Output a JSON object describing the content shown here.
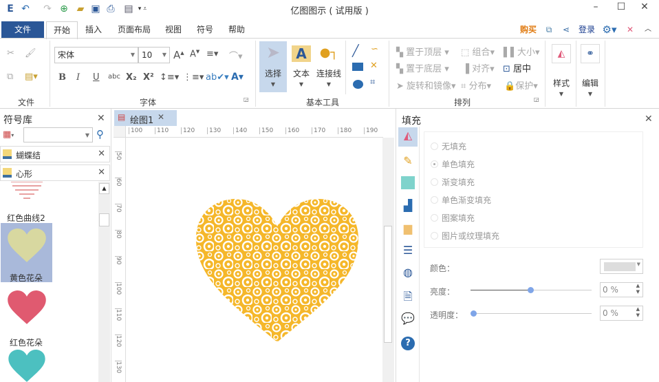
{
  "window": {
    "title": "亿图图示 ( 试用版 )",
    "minimize": "–",
    "maximize": "☐",
    "close": "✕"
  },
  "quick_access": [
    "app-logo",
    "undo",
    "redo",
    "new",
    "open",
    "save",
    "print",
    "export",
    "customize"
  ],
  "tabs": {
    "file": "文件",
    "items": [
      "开始",
      "插入",
      "页面布局",
      "视图",
      "符号",
      "帮助"
    ],
    "active": 0
  },
  "top_right": {
    "buy": "购买",
    "login": "登录"
  },
  "ribbon": {
    "file_group": "文件",
    "font_group": "字体",
    "font_name": "宋体",
    "font_size": "10",
    "format_buttons": [
      "B",
      "I",
      "U",
      "abc",
      "X₂",
      "X²"
    ],
    "basic_tools_group": "基本工具",
    "select": "选择",
    "text": "文本",
    "connector": "连接线",
    "arrange_group": "排列",
    "arrange": [
      "置于顶层",
      "置于底层",
      "旋转和镜像",
      "组合",
      "对齐",
      "分布",
      "大小",
      "居中",
      "保护"
    ],
    "style": "样式",
    "edit": "编辑"
  },
  "library": {
    "title": "符号库",
    "search_placeholder": "",
    "categories": [
      "蝴蝶结",
      "心形"
    ],
    "symbols": [
      "红色曲线2",
      "黄色花朵",
      "红色花朵"
    ],
    "selected": 1
  },
  "document_tab": "绘图1",
  "ruler": {
    "h": [
      "100",
      "110",
      "120",
      "130",
      "140",
      "150",
      "160",
      "170",
      "180",
      "190"
    ],
    "v": [
      "50",
      "60",
      "70",
      "80",
      "90",
      "100",
      "110",
      "120",
      "130"
    ]
  },
  "fill_panel": {
    "title": "填充",
    "options": [
      "无填充",
      "单色填充",
      "渐变填充",
      "单色渐变填充",
      "图案填充",
      "图片或纹理填充"
    ],
    "selected": 1,
    "color_label": "颜色：",
    "brightness_label": "亮度：",
    "brightness_value": "0 %",
    "brightness_fraction": 0.5,
    "transparency_label": "透明度：",
    "transparency_value": "0 %",
    "transparency_fraction": 0.0
  },
  "colors": {
    "accent": "#2b5797",
    "heart": "#f5b72a",
    "buy": "#e07b12"
  }
}
